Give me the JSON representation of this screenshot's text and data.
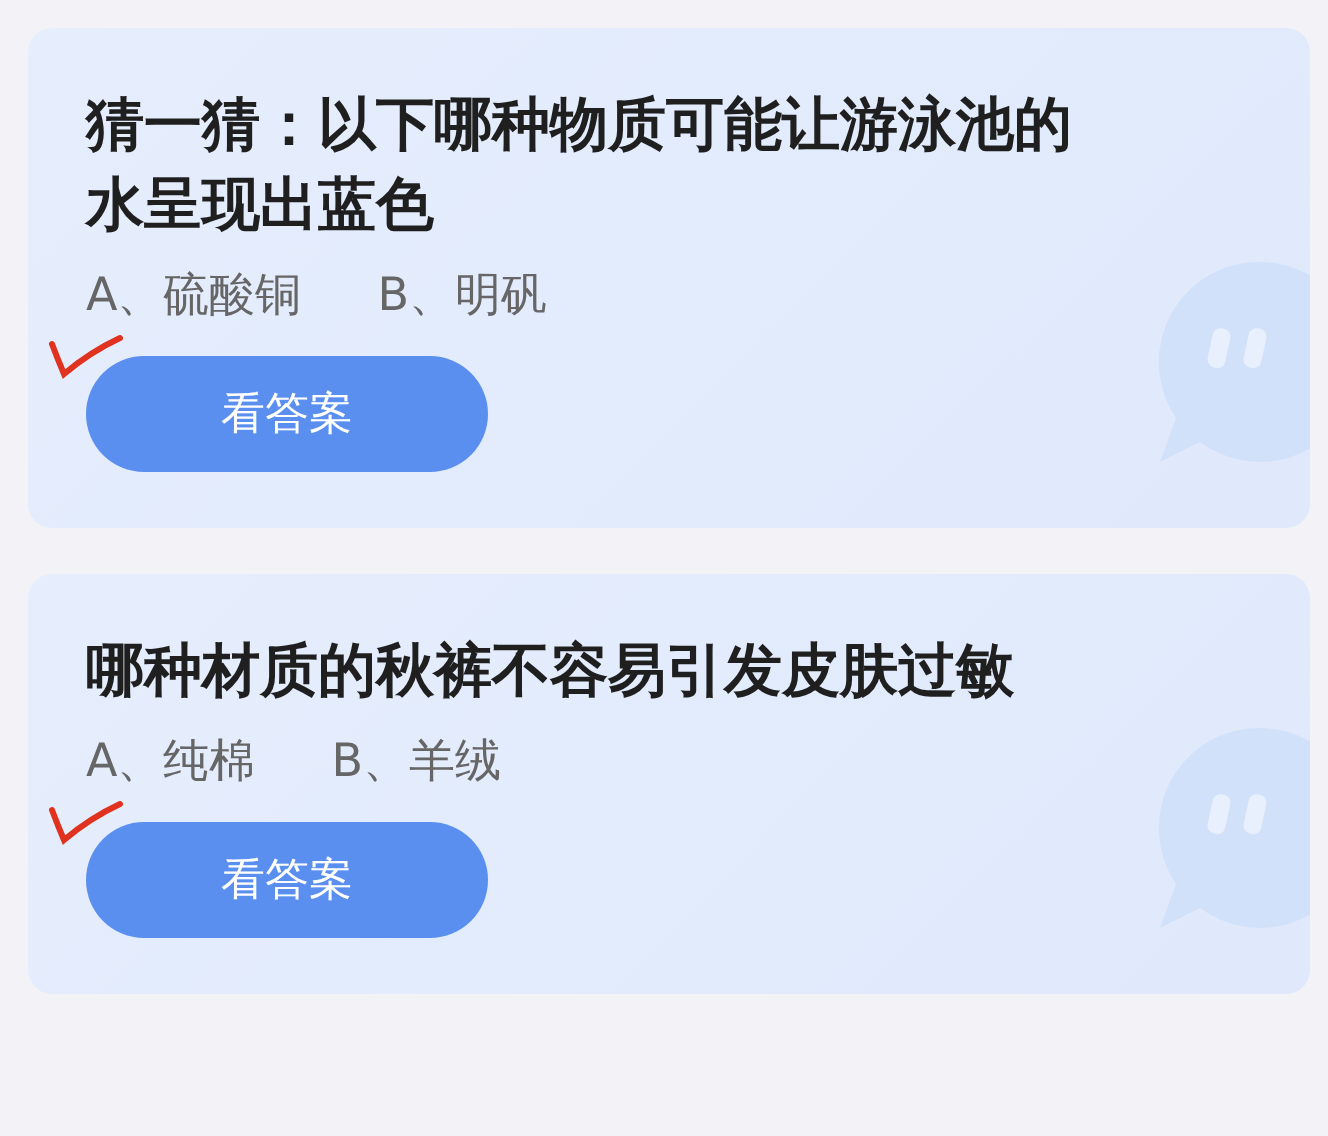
{
  "cards": [
    {
      "question": "猜一猜：以下哪种物质可能让游泳池的水呈现出蓝色",
      "options": [
        "A、硫酸铜",
        "B、明矾"
      ],
      "ticked": true,
      "button": "看答案"
    },
    {
      "question": "哪种材质的秋裤不容易引发皮肤过敏",
      "options": [
        "A、纯棉",
        "B、羊绒"
      ],
      "ticked": true,
      "button": "看答案"
    }
  ]
}
